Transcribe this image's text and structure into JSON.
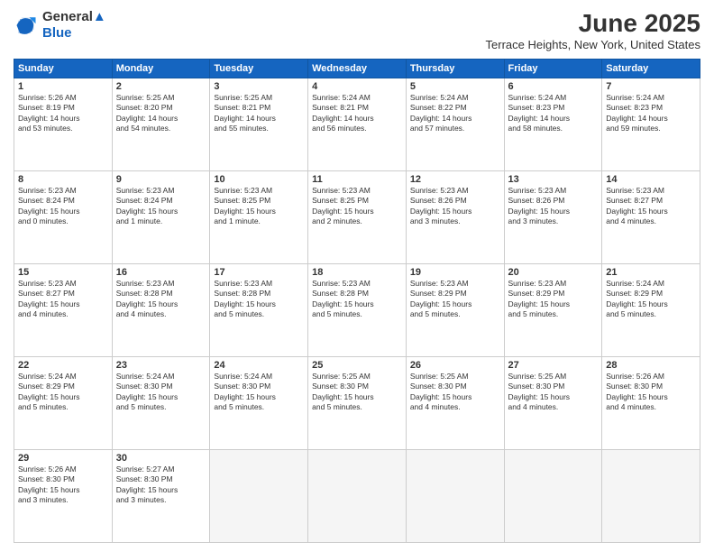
{
  "logo": {
    "line1": "General",
    "line2": "Blue"
  },
  "title": "June 2025",
  "location": "Terrace Heights, New York, United States",
  "days_of_week": [
    "Sunday",
    "Monday",
    "Tuesday",
    "Wednesday",
    "Thursday",
    "Friday",
    "Saturday"
  ],
  "weeks": [
    [
      {
        "day": "1",
        "info": "Sunrise: 5:26 AM\nSunset: 8:19 PM\nDaylight: 14 hours\nand 53 minutes."
      },
      {
        "day": "2",
        "info": "Sunrise: 5:25 AM\nSunset: 8:20 PM\nDaylight: 14 hours\nand 54 minutes."
      },
      {
        "day": "3",
        "info": "Sunrise: 5:25 AM\nSunset: 8:21 PM\nDaylight: 14 hours\nand 55 minutes."
      },
      {
        "day": "4",
        "info": "Sunrise: 5:24 AM\nSunset: 8:21 PM\nDaylight: 14 hours\nand 56 minutes."
      },
      {
        "day": "5",
        "info": "Sunrise: 5:24 AM\nSunset: 8:22 PM\nDaylight: 14 hours\nand 57 minutes."
      },
      {
        "day": "6",
        "info": "Sunrise: 5:24 AM\nSunset: 8:23 PM\nDaylight: 14 hours\nand 58 minutes."
      },
      {
        "day": "7",
        "info": "Sunrise: 5:24 AM\nSunset: 8:23 PM\nDaylight: 14 hours\nand 59 minutes."
      }
    ],
    [
      {
        "day": "8",
        "info": "Sunrise: 5:23 AM\nSunset: 8:24 PM\nDaylight: 15 hours\nand 0 minutes."
      },
      {
        "day": "9",
        "info": "Sunrise: 5:23 AM\nSunset: 8:24 PM\nDaylight: 15 hours\nand 1 minute."
      },
      {
        "day": "10",
        "info": "Sunrise: 5:23 AM\nSunset: 8:25 PM\nDaylight: 15 hours\nand 1 minute."
      },
      {
        "day": "11",
        "info": "Sunrise: 5:23 AM\nSunset: 8:25 PM\nDaylight: 15 hours\nand 2 minutes."
      },
      {
        "day": "12",
        "info": "Sunrise: 5:23 AM\nSunset: 8:26 PM\nDaylight: 15 hours\nand 3 minutes."
      },
      {
        "day": "13",
        "info": "Sunrise: 5:23 AM\nSunset: 8:26 PM\nDaylight: 15 hours\nand 3 minutes."
      },
      {
        "day": "14",
        "info": "Sunrise: 5:23 AM\nSunset: 8:27 PM\nDaylight: 15 hours\nand 4 minutes."
      }
    ],
    [
      {
        "day": "15",
        "info": "Sunrise: 5:23 AM\nSunset: 8:27 PM\nDaylight: 15 hours\nand 4 minutes."
      },
      {
        "day": "16",
        "info": "Sunrise: 5:23 AM\nSunset: 8:28 PM\nDaylight: 15 hours\nand 4 minutes."
      },
      {
        "day": "17",
        "info": "Sunrise: 5:23 AM\nSunset: 8:28 PM\nDaylight: 15 hours\nand 5 minutes."
      },
      {
        "day": "18",
        "info": "Sunrise: 5:23 AM\nSunset: 8:28 PM\nDaylight: 15 hours\nand 5 minutes."
      },
      {
        "day": "19",
        "info": "Sunrise: 5:23 AM\nSunset: 8:29 PM\nDaylight: 15 hours\nand 5 minutes."
      },
      {
        "day": "20",
        "info": "Sunrise: 5:23 AM\nSunset: 8:29 PM\nDaylight: 15 hours\nand 5 minutes."
      },
      {
        "day": "21",
        "info": "Sunrise: 5:24 AM\nSunset: 8:29 PM\nDaylight: 15 hours\nand 5 minutes."
      }
    ],
    [
      {
        "day": "22",
        "info": "Sunrise: 5:24 AM\nSunset: 8:29 PM\nDaylight: 15 hours\nand 5 minutes."
      },
      {
        "day": "23",
        "info": "Sunrise: 5:24 AM\nSunset: 8:30 PM\nDaylight: 15 hours\nand 5 minutes."
      },
      {
        "day": "24",
        "info": "Sunrise: 5:24 AM\nSunset: 8:30 PM\nDaylight: 15 hours\nand 5 minutes."
      },
      {
        "day": "25",
        "info": "Sunrise: 5:25 AM\nSunset: 8:30 PM\nDaylight: 15 hours\nand 5 minutes."
      },
      {
        "day": "26",
        "info": "Sunrise: 5:25 AM\nSunset: 8:30 PM\nDaylight: 15 hours\nand 4 minutes."
      },
      {
        "day": "27",
        "info": "Sunrise: 5:25 AM\nSunset: 8:30 PM\nDaylight: 15 hours\nand 4 minutes."
      },
      {
        "day": "28",
        "info": "Sunrise: 5:26 AM\nSunset: 8:30 PM\nDaylight: 15 hours\nand 4 minutes."
      }
    ],
    [
      {
        "day": "29",
        "info": "Sunrise: 5:26 AM\nSunset: 8:30 PM\nDaylight: 15 hours\nand 3 minutes."
      },
      {
        "day": "30",
        "info": "Sunrise: 5:27 AM\nSunset: 8:30 PM\nDaylight: 15 hours\nand 3 minutes."
      },
      {
        "day": "",
        "info": ""
      },
      {
        "day": "",
        "info": ""
      },
      {
        "day": "",
        "info": ""
      },
      {
        "day": "",
        "info": ""
      },
      {
        "day": "",
        "info": ""
      }
    ]
  ]
}
